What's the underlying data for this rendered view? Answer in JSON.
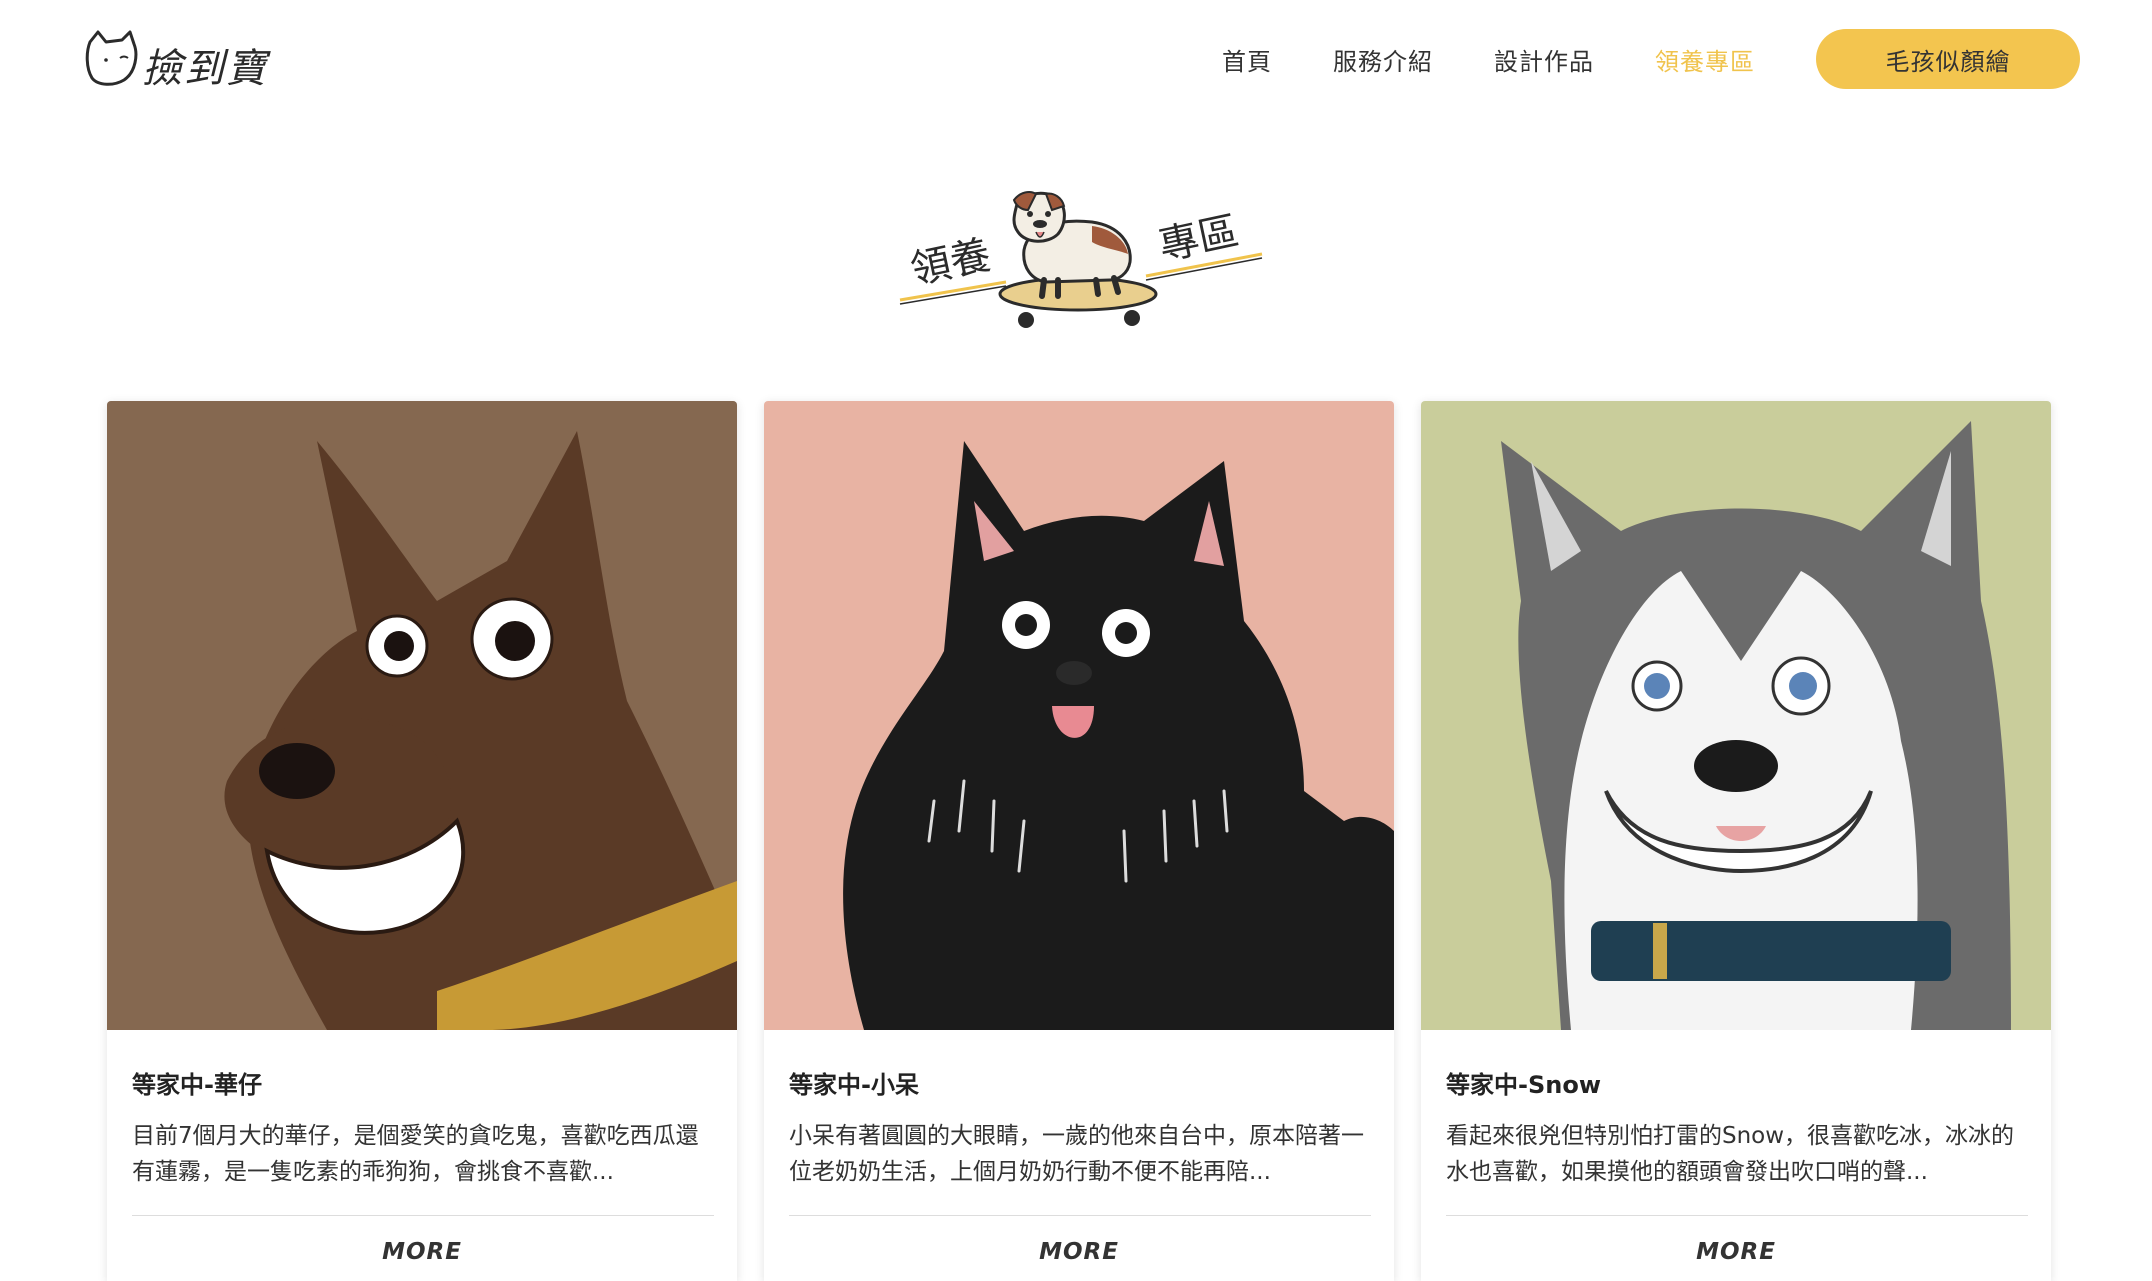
{
  "brand": {
    "logo_text": "撿到寶"
  },
  "nav": {
    "items": [
      {
        "label": "首頁",
        "active": false
      },
      {
        "label": "服務介紹",
        "active": false
      },
      {
        "label": "設計作品",
        "active": false
      },
      {
        "label": "領養專區",
        "active": true
      }
    ],
    "cta_label": "毛孩似顏繪"
  },
  "section": {
    "title_left": "領養",
    "title_right": "專區"
  },
  "colors": {
    "accent": "#f3c54f",
    "active_nav": "#f0c34c"
  },
  "cards": [
    {
      "title": "等家中-華仔",
      "description": "目前7個月大的華仔，是個愛笑的貪吃鬼，喜歡吃西瓜還有蓮霧，是一隻吃素的乖狗狗，會挑食不喜歡...",
      "more": "MORE",
      "image_bg": "#8a6e55"
    },
    {
      "title": "等家中-小呆",
      "description": "小呆有著圓圓的大眼睛，一歲的他來自台中，原本陪著一位老奶奶生活，上個月奶奶行動不便不能再陪...",
      "more": "MORE",
      "image_bg": "#e8b3a3"
    },
    {
      "title": "等家中-Snow",
      "description": "看起來很兇但特別怕打雷的Snow，很喜歡吃冰，冰冰的水也喜歡，如果摸他的額頭會發出吹口哨的聲...",
      "more": "MORE",
      "image_bg": "#c9cd9b"
    }
  ]
}
